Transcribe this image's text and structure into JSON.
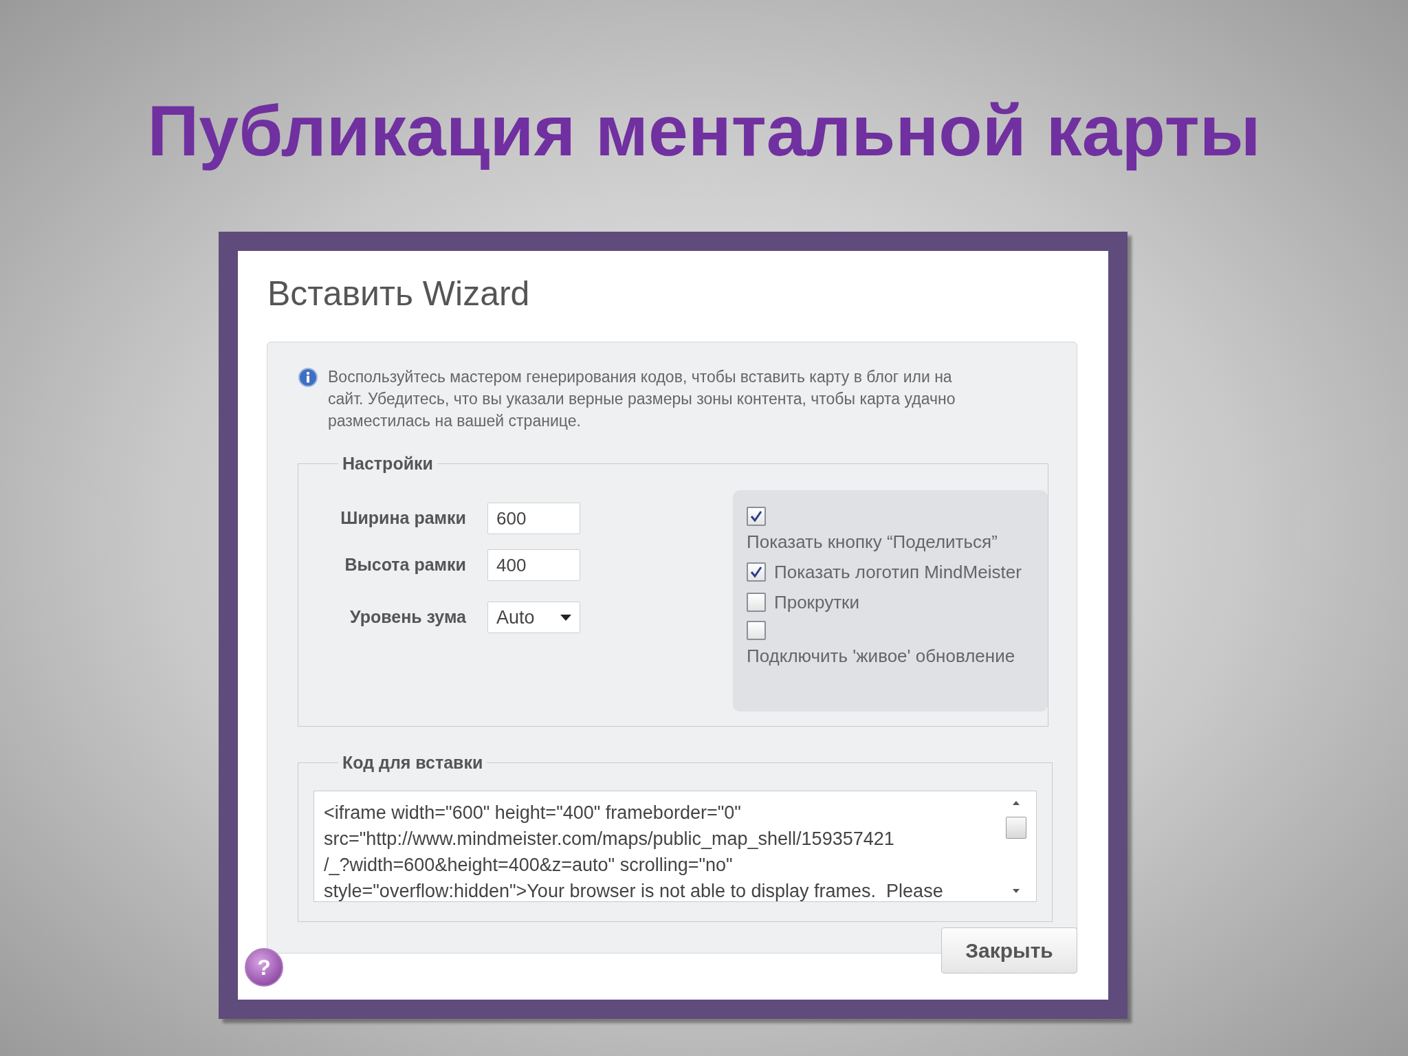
{
  "slide_title": "Публикация ментальной карты",
  "dialog": {
    "title": "Вставить Wizard",
    "info": "Воспользуйтесь мастером генерирования кодов, чтобы вставить карту в блог или на сайт. Убедитесь, что вы указали верные размеры зоны контента, чтобы карта удачно разместилась на вашей странице.",
    "settings": {
      "legend": "Настройки",
      "fields": [
        {
          "kind": "input",
          "label": "Ширина рамки",
          "value": "600"
        },
        {
          "kind": "input",
          "label": "Высота рамки",
          "value": "400"
        },
        {
          "kind": "select",
          "label": "Уровень зума",
          "value": "Auto"
        }
      ],
      "options": [
        {
          "kind": "label_below",
          "label": "Показать кнопку “Поделиться”",
          "checked": true
        },
        {
          "kind": "label_right",
          "label": "Показать логотип MindMeister",
          "checked": true
        },
        {
          "kind": "label_right",
          "label": "Прокрутки",
          "checked": false
        },
        {
          "kind": "label_below",
          "label": "Подключить 'живое' обновление",
          "checked": false
        }
      ]
    },
    "embed": {
      "legend": "Код для вставки",
      "code_lines": [
        "<iframe width=\"600\" height=\"400\" frameborder=\"0\"",
        "src=\"http://www.mindmeister.com/maps/public_map_shell/159357421",
        "/_?width=600&height=400&z=auto\" scrolling=\"no\"",
        "style=\"overflow:hidden\">Your browser is not able to display frames.  Please"
      ]
    },
    "help_button": "?",
    "close_button": "Закрыть"
  }
}
